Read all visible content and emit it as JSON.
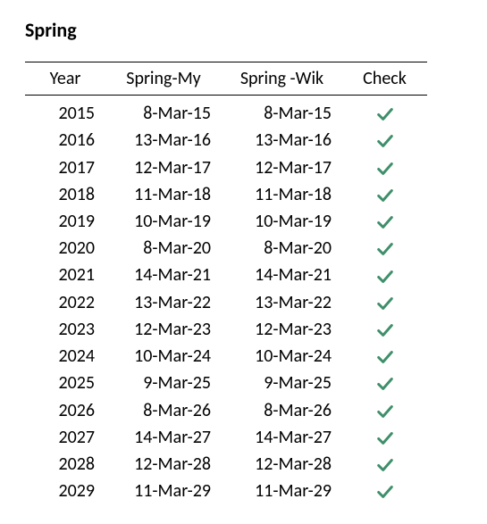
{
  "title": "Spring",
  "columns": {
    "year": "Year",
    "my": "Spring-My",
    "wik": "Spring -Wik",
    "check": "Check"
  },
  "chart_data": {
    "type": "table",
    "columns": [
      "Year",
      "Spring-My",
      "Spring -Wik",
      "Check"
    ],
    "rows": [
      {
        "year": "2015",
        "my": "8-Mar-15",
        "wik": "8-Mar-15",
        "check": true
      },
      {
        "year": "2016",
        "my": "13-Mar-16",
        "wik": "13-Mar-16",
        "check": true
      },
      {
        "year": "2017",
        "my": "12-Mar-17",
        "wik": "12-Mar-17",
        "check": true
      },
      {
        "year": "2018",
        "my": "11-Mar-18",
        "wik": "11-Mar-18",
        "check": true
      },
      {
        "year": "2019",
        "my": "10-Mar-19",
        "wik": "10-Mar-19",
        "check": true
      },
      {
        "year": "2020",
        "my": "8-Mar-20",
        "wik": "8-Mar-20",
        "check": true
      },
      {
        "year": "2021",
        "my": "14-Mar-21",
        "wik": "14-Mar-21",
        "check": true
      },
      {
        "year": "2022",
        "my": "13-Mar-22",
        "wik": "13-Mar-22",
        "check": true
      },
      {
        "year": "2023",
        "my": "12-Mar-23",
        "wik": "12-Mar-23",
        "check": true
      },
      {
        "year": "2024",
        "my": "10-Mar-24",
        "wik": "10-Mar-24",
        "check": true
      },
      {
        "year": "2025",
        "my": "9-Mar-25",
        "wik": "9-Mar-25",
        "check": true
      },
      {
        "year": "2026",
        "my": "8-Mar-26",
        "wik": "8-Mar-26",
        "check": true
      },
      {
        "year": "2027",
        "my": "14-Mar-27",
        "wik": "14-Mar-27",
        "check": true
      },
      {
        "year": "2028",
        "my": "12-Mar-28",
        "wik": "12-Mar-28",
        "check": true
      },
      {
        "year": "2029",
        "my": "11-Mar-29",
        "wik": "11-Mar-29",
        "check": true
      }
    ]
  }
}
